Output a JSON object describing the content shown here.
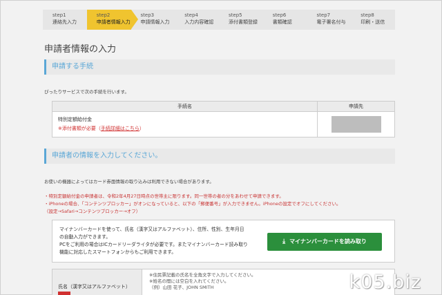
{
  "steps": [
    {
      "num": "step1",
      "label": "連絡先入力",
      "active": false
    },
    {
      "num": "step2",
      "label": "申請者情報入力",
      "active": true
    },
    {
      "num": "step3",
      "label": "申請情報入力",
      "active": false
    },
    {
      "num": "step4",
      "label": "入力内容確認",
      "active": false
    },
    {
      "num": "step5",
      "label": "添付書類登録",
      "active": false
    },
    {
      "num": "step6",
      "label": "書類確認",
      "active": false
    },
    {
      "num": "step7",
      "label": "電子署名付与",
      "active": false
    },
    {
      "num": "step8",
      "label": "印刷・送信",
      "active": false
    }
  ],
  "page_title": "申請者情報の入力",
  "section1": {
    "heading": "申請する手続",
    "intro": "ぴったりサービスで次の手続を行います。",
    "table": {
      "col_name": "手続名",
      "col_dest": "申請先",
      "proc_name": "特別定額給付金",
      "proc_req": "※添付書類が必要",
      "proc_link": "手続詳細はこちら"
    }
  },
  "section2": {
    "heading": "申請者の情報を入力してください。",
    "note1": "お使いの機器によってはカード券面情報の取り込みは利用できない場合があります。",
    "red_notes": [
      "・特別定額給付金の申請者は、令和2年4月27日時点の世帯主に限ります。同一世帯の者の分をあわせて申請できます。",
      "・iPhoneの場合、「コンテンツブロッカー」がオンになっていると、以下の「郵便番号」が入力できません。iPhoneの設定でオフにしてください。",
      "（設定→Safari→コンテンツブロッカー→オフ）"
    ],
    "mynumber": {
      "lines": [
        "マイナンバーカードを使って、氏名（漢字又はアルファベット）、住所、性別、生年月日",
        "の自動入力ができます。",
        "PCをご利用の場合はICカードリーダライタが必要です。またマイナンバーカード読み取り",
        "機能に対応したスマートフォンからもご利用できます。"
      ],
      "button_label": "マイナンバーカードを読み取り",
      "button_icon": "download-icon",
      "button_color": "#2b8f3c"
    },
    "name_field": {
      "label": "氏名（漢字又はアルファベット）",
      "hints": [
        "※住民票記載の氏名を全角文字で入力してください。",
        "※姓名の間には空白を入れてください。",
        "（例）山田 花子、JOHN SMITH"
      ]
    }
  },
  "watermark": "k05.biz",
  "colors": {
    "accent_blue": "#5aa7d6",
    "active_step": "#f0c42f",
    "warning_red": "#c83232"
  }
}
